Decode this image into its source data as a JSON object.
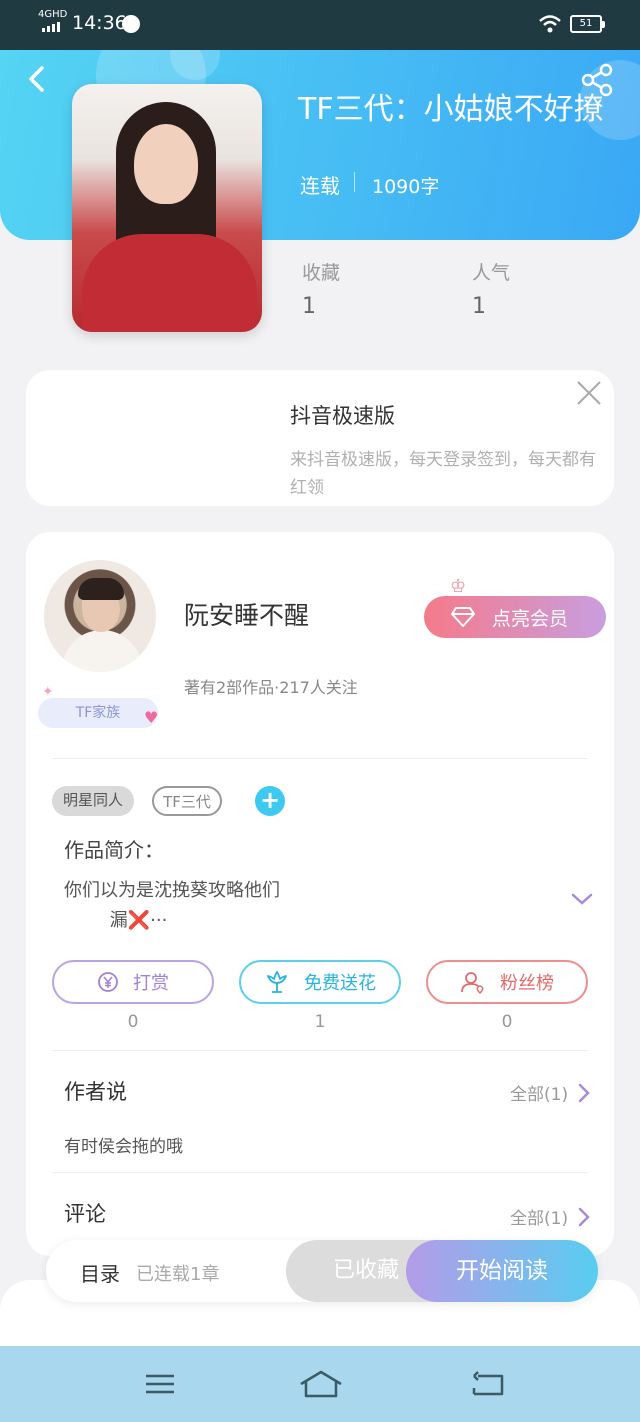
{
  "status_bar": {
    "network": "4GHD",
    "time": "14:36",
    "battery": "51"
  },
  "book": {
    "title": "TF三代：小姑娘不好撩",
    "status": "连载",
    "word_count": "1090字",
    "stats": [
      {
        "label": "收藏",
        "value": "1"
      },
      {
        "label": "人气",
        "value": "1"
      }
    ]
  },
  "ad": {
    "title": "抖音极速版",
    "description": "来抖音极速版，每天登录签到，每天都有红领"
  },
  "author": {
    "name": "阮安睡不醒",
    "meta": "著有2部作品·217人关注",
    "family_badge": "TF家族",
    "vip_button": "点亮会员"
  },
  "tags": [
    "明星同人",
    "TF三代"
  ],
  "intro": {
    "label": "作品简介：",
    "text": "你们以为是沈挽葵攻略他们\n        漏❌···"
  },
  "actions": [
    {
      "label": "打赏",
      "count": "0"
    },
    {
      "label": "免费送花",
      "count": "1"
    },
    {
      "label": "粉丝榜",
      "count": "0"
    }
  ],
  "author_says": {
    "title": "作者说",
    "more": "全部(1)",
    "content": "有时侯会拖的哦"
  },
  "comments": {
    "title": "评论",
    "more": "全部(1)"
  },
  "bottom_bar": {
    "toc_label": "目录",
    "toc_status": "已连载1章",
    "collected_label": "已收藏",
    "read_label": "开始阅读"
  },
  "colors": {
    "header_start": "#55d4f3",
    "header_end": "#3aa8f5",
    "accent_cyan": "#3ec9f0",
    "vip_pink": "#f57a8a",
    "vip_purple": "#c99ee0"
  },
  "icons": [
    "back-icon",
    "share-icon",
    "close-icon",
    "diamond-icon",
    "crown-icon",
    "plus-icon",
    "chevron-down-icon",
    "yen-icon",
    "flower-icon",
    "fans-icon",
    "chevron-right-icon",
    "menu-icon",
    "home-icon",
    "return-icon"
  ]
}
